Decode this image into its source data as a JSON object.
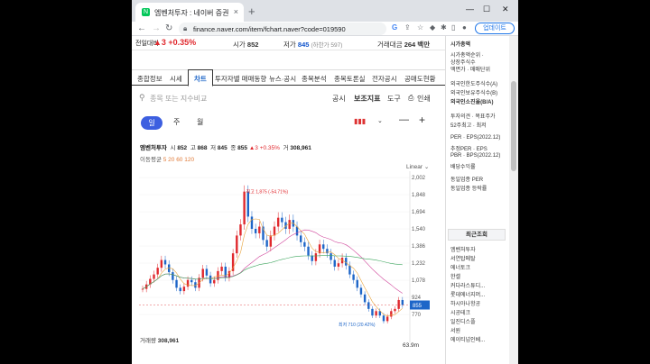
{
  "browser": {
    "tab_title": "엠벤처투자 : 네이버 증권",
    "tab_close": "×",
    "new_tab": "+",
    "url": "finance.naver.com/item/fchart.naver?code=019590",
    "update_label": "업데이트"
  },
  "stock": {
    "name": "전일대비",
    "change": "▲3 +0.35%",
    "price_label": "시가",
    "price_open": "852",
    "low_label": "저가",
    "low_value": "845",
    "low_sub": "(하한가 597)",
    "amount_label": "거래대금",
    "amount_value": "264 백만"
  },
  "menu": [
    "종합정보",
    "시세",
    "차트",
    "투자자별 매매동향",
    "뉴스·공시",
    "종목분석",
    "종목토론실",
    "전자공시",
    "공매도현황"
  ],
  "toolbar": {
    "search_placeholder": "종목 또는 지수비교",
    "disclosure": "공시",
    "indicator": "보조지표",
    "tools": "도구",
    "print": "인쇄"
  },
  "periods": [
    "일",
    "주",
    "월"
  ],
  "quote": {
    "name": "엠벤처투자",
    "open_l": "시",
    "open_v": "852",
    "high_l": "고",
    "high_v": "868",
    "low_l": "저",
    "low_v": "845",
    "close_l": "종",
    "close_v": "855",
    "chg": "▲3 +0.35%",
    "vol_l": "거",
    "vol_v": "308,961"
  },
  "ma": {
    "label": "이동평균",
    "periods": "5  20  60  120"
  },
  "scale_label": "Linear",
  "chart_data": {
    "type": "candlestick",
    "y_ticks": [
      "2,002",
      "1,848",
      "1,694",
      "1,540",
      "1,386",
      "1,232",
      "1,078",
      "924",
      "770"
    ],
    "ylim": [
      770,
      2002
    ],
    "max_annotation": "최고 1,875 (-54.71%)",
    "min_annotation": "최저 710 (20.42%)",
    "current_price": "855",
    "close_series": [
      1000,
      1040,
      1090,
      1130,
      1190,
      1260,
      1220,
      1150,
      1080,
      1010,
      980,
      1020,
      1080,
      1060,
      1010,
      1100,
      1180,
      1120,
      1050,
      1080,
      1160,
      1200,
      1100,
      1160,
      1320,
      1480,
      1580,
      1875,
      1650,
      1540,
      1500,
      1560,
      1440,
      1380,
      1480,
      1560,
      1640,
      1600,
      1540,
      1620,
      1560,
      1480,
      1420,
      1380,
      1300,
      1250,
      1320,
      1400,
      1360,
      1320,
      1260,
      1200,
      1230,
      1280,
      1210,
      1130,
      1080,
      1010,
      950,
      880,
      820,
      760,
      800,
      760,
      710,
      750,
      800,
      820,
      900,
      855
    ]
  },
  "volume": {
    "label": "거래량",
    "value": "308,961",
    "axis_max": "63.9m"
  },
  "right_panel": {
    "items": [
      "시가총액",
      "시가총액순위 ·",
      "상장주식수",
      "액면가 · 매매단위",
      "외국인한도주식수(A)",
      "외국인보유주식수(B)",
      "외국인소진율(B/A)",
      "투자의견 · 목표주가",
      "52주최고 · 최저",
      "PER · EPS(2022.12)",
      "추정PER · EPS",
      "PBR · BPS(2022.12)",
      "배당수익률",
      "동일업종 PER",
      "동일업종 등락률"
    ],
    "recent_header": "최근조회",
    "recent": [
      "엠벤처투자",
      "서연탑메탈",
      "에너토크",
      "한셀",
      "커다라스튜디...",
      "롯데에너지머...",
      "하시아나항공",
      "시공테크",
      "일진디스플",
      "서원",
      "에이티넘인베..."
    ]
  }
}
